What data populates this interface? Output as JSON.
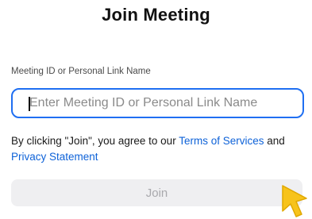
{
  "title": "Join Meeting",
  "meeting_field": {
    "label": "Meeting ID or Personal Link Name",
    "value": "",
    "placeholder": "Enter Meeting ID or Personal Link Name"
  },
  "agreement": {
    "prefix": "By clicking \"Join\", you agree to our ",
    "terms_link": "Terms of Services",
    "middle": " and ",
    "privacy_link": "Privacy Statement"
  },
  "join_button": {
    "label": "Join",
    "state": "disabled"
  },
  "colors": {
    "accent": "#1f6ff2",
    "link": "#0e62d8",
    "button_bg": "#efeff1",
    "button_text": "#a9a9ad",
    "cursor": "#f7c31b"
  },
  "icons": {
    "pointer": "arrow-cursor-icon"
  }
}
